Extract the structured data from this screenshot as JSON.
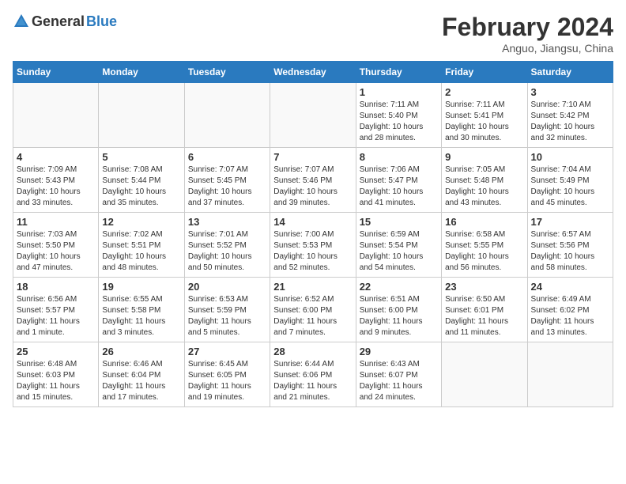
{
  "logo": {
    "general": "General",
    "blue": "Blue"
  },
  "header": {
    "month": "February 2024",
    "location": "Anguo, Jiangsu, China"
  },
  "weekdays": [
    "Sunday",
    "Monday",
    "Tuesday",
    "Wednesday",
    "Thursday",
    "Friday",
    "Saturday"
  ],
  "weeks": [
    [
      {
        "day": "",
        "info": ""
      },
      {
        "day": "",
        "info": ""
      },
      {
        "day": "",
        "info": ""
      },
      {
        "day": "",
        "info": ""
      },
      {
        "day": "1",
        "info": "Sunrise: 7:11 AM\nSunset: 5:40 PM\nDaylight: 10 hours\nand 28 minutes."
      },
      {
        "day": "2",
        "info": "Sunrise: 7:11 AM\nSunset: 5:41 PM\nDaylight: 10 hours\nand 30 minutes."
      },
      {
        "day": "3",
        "info": "Sunrise: 7:10 AM\nSunset: 5:42 PM\nDaylight: 10 hours\nand 32 minutes."
      }
    ],
    [
      {
        "day": "4",
        "info": "Sunrise: 7:09 AM\nSunset: 5:43 PM\nDaylight: 10 hours\nand 33 minutes."
      },
      {
        "day": "5",
        "info": "Sunrise: 7:08 AM\nSunset: 5:44 PM\nDaylight: 10 hours\nand 35 minutes."
      },
      {
        "day": "6",
        "info": "Sunrise: 7:07 AM\nSunset: 5:45 PM\nDaylight: 10 hours\nand 37 minutes."
      },
      {
        "day": "7",
        "info": "Sunrise: 7:07 AM\nSunset: 5:46 PM\nDaylight: 10 hours\nand 39 minutes."
      },
      {
        "day": "8",
        "info": "Sunrise: 7:06 AM\nSunset: 5:47 PM\nDaylight: 10 hours\nand 41 minutes."
      },
      {
        "day": "9",
        "info": "Sunrise: 7:05 AM\nSunset: 5:48 PM\nDaylight: 10 hours\nand 43 minutes."
      },
      {
        "day": "10",
        "info": "Sunrise: 7:04 AM\nSunset: 5:49 PM\nDaylight: 10 hours\nand 45 minutes."
      }
    ],
    [
      {
        "day": "11",
        "info": "Sunrise: 7:03 AM\nSunset: 5:50 PM\nDaylight: 10 hours\nand 47 minutes."
      },
      {
        "day": "12",
        "info": "Sunrise: 7:02 AM\nSunset: 5:51 PM\nDaylight: 10 hours\nand 48 minutes."
      },
      {
        "day": "13",
        "info": "Sunrise: 7:01 AM\nSunset: 5:52 PM\nDaylight: 10 hours\nand 50 minutes."
      },
      {
        "day": "14",
        "info": "Sunrise: 7:00 AM\nSunset: 5:53 PM\nDaylight: 10 hours\nand 52 minutes."
      },
      {
        "day": "15",
        "info": "Sunrise: 6:59 AM\nSunset: 5:54 PM\nDaylight: 10 hours\nand 54 minutes."
      },
      {
        "day": "16",
        "info": "Sunrise: 6:58 AM\nSunset: 5:55 PM\nDaylight: 10 hours\nand 56 minutes."
      },
      {
        "day": "17",
        "info": "Sunrise: 6:57 AM\nSunset: 5:56 PM\nDaylight: 10 hours\nand 58 minutes."
      }
    ],
    [
      {
        "day": "18",
        "info": "Sunrise: 6:56 AM\nSunset: 5:57 PM\nDaylight: 11 hours\nand 1 minute."
      },
      {
        "day": "19",
        "info": "Sunrise: 6:55 AM\nSunset: 5:58 PM\nDaylight: 11 hours\nand 3 minutes."
      },
      {
        "day": "20",
        "info": "Sunrise: 6:53 AM\nSunset: 5:59 PM\nDaylight: 11 hours\nand 5 minutes."
      },
      {
        "day": "21",
        "info": "Sunrise: 6:52 AM\nSunset: 6:00 PM\nDaylight: 11 hours\nand 7 minutes."
      },
      {
        "day": "22",
        "info": "Sunrise: 6:51 AM\nSunset: 6:00 PM\nDaylight: 11 hours\nand 9 minutes."
      },
      {
        "day": "23",
        "info": "Sunrise: 6:50 AM\nSunset: 6:01 PM\nDaylight: 11 hours\nand 11 minutes."
      },
      {
        "day": "24",
        "info": "Sunrise: 6:49 AM\nSunset: 6:02 PM\nDaylight: 11 hours\nand 13 minutes."
      }
    ],
    [
      {
        "day": "25",
        "info": "Sunrise: 6:48 AM\nSunset: 6:03 PM\nDaylight: 11 hours\nand 15 minutes."
      },
      {
        "day": "26",
        "info": "Sunrise: 6:46 AM\nSunset: 6:04 PM\nDaylight: 11 hours\nand 17 minutes."
      },
      {
        "day": "27",
        "info": "Sunrise: 6:45 AM\nSunset: 6:05 PM\nDaylight: 11 hours\nand 19 minutes."
      },
      {
        "day": "28",
        "info": "Sunrise: 6:44 AM\nSunset: 6:06 PM\nDaylight: 11 hours\nand 21 minutes."
      },
      {
        "day": "29",
        "info": "Sunrise: 6:43 AM\nSunset: 6:07 PM\nDaylight: 11 hours\nand 24 minutes."
      },
      {
        "day": "",
        "info": ""
      },
      {
        "day": "",
        "info": ""
      }
    ]
  ]
}
